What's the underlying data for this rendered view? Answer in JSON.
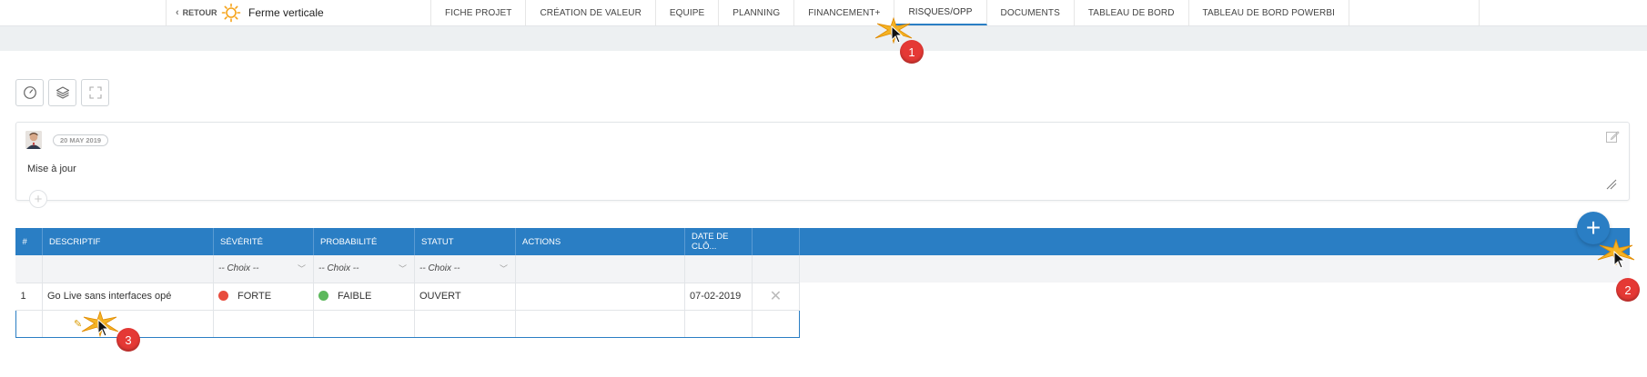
{
  "nav": {
    "back_label": "RETOUR",
    "project_name": "Ferme verticale",
    "tabs": [
      {
        "label": "FICHE PROJET"
      },
      {
        "label": "CRÉATION DE VALEUR"
      },
      {
        "label": "EQUIPE"
      },
      {
        "label": "PLANNING"
      },
      {
        "label": "FINANCEMENT+"
      },
      {
        "label": "RISQUES/OPP"
      },
      {
        "label": "DOCUMENTS"
      },
      {
        "label": "TABLEAU DE BORD"
      },
      {
        "label": "TABLEAU DE BORD POWERBI"
      }
    ],
    "active_tab": "RISQUES/OPP"
  },
  "toolbar": {
    "icons": [
      "gauge-icon",
      "layers-icon",
      "fullscreen-icon"
    ]
  },
  "comment": {
    "date": "20 MAY 2019",
    "text": "Mise à jour"
  },
  "table": {
    "headers": [
      "#",
      "DESCRIPTIF",
      "SÉVÉRITÉ",
      "PROBABILITÉ",
      "STATUT",
      "ACTIONS",
      "DATE DE CLÔ..."
    ],
    "filter_placeholder": "-- Choix --",
    "rows": [
      {
        "num": "1",
        "descriptif": "Go Live sans interfaces opé",
        "severite": "FORTE",
        "severite_color": "#e84c3d",
        "probabilite": "FAIBLE",
        "probabilite_color": "#5cb85c",
        "statut": "OUVERT",
        "actions": "",
        "date_cloture": "07-02-2019"
      }
    ]
  },
  "markers": [
    "1",
    "2",
    "3"
  ],
  "colors": {
    "accent": "#2a7ec4",
    "marker": "#e53935"
  }
}
